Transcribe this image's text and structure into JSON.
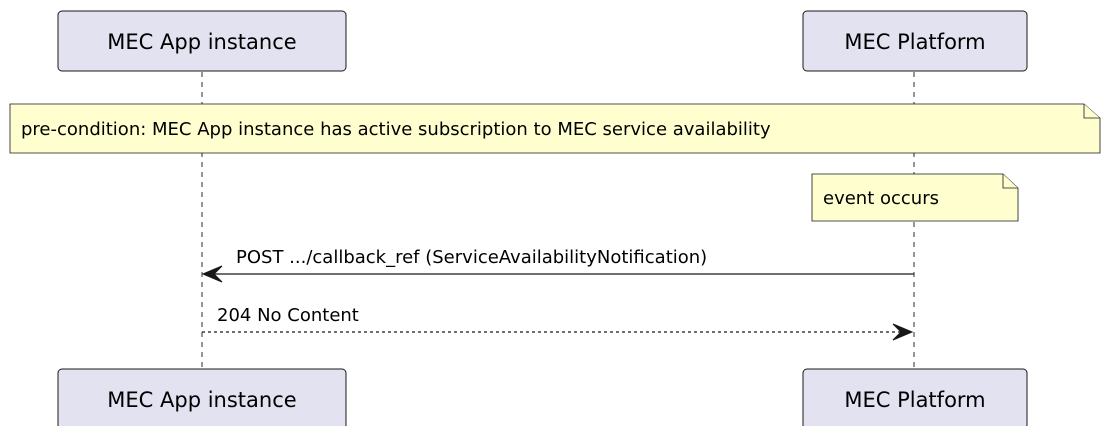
{
  "participants": {
    "app": {
      "name": "MEC App instance"
    },
    "platform": {
      "name": "MEC Platform"
    }
  },
  "notes": {
    "precondition": "pre-condition: MEC App instance has active subscription to MEC service availability",
    "event": "event occurs"
  },
  "messages": [
    {
      "from": "MEC Platform",
      "to": "MEC App instance",
      "label": "POST .../callback_ref (ServiceAvailabilityNotification)",
      "style": "solid"
    },
    {
      "from": "MEC App instance",
      "to": "MEC Platform",
      "label": "204 No Content",
      "style": "dashed"
    }
  ],
  "colors": {
    "participant_fill": "#e2e2f0",
    "note_fill": "#fefece",
    "line": "#181818"
  }
}
